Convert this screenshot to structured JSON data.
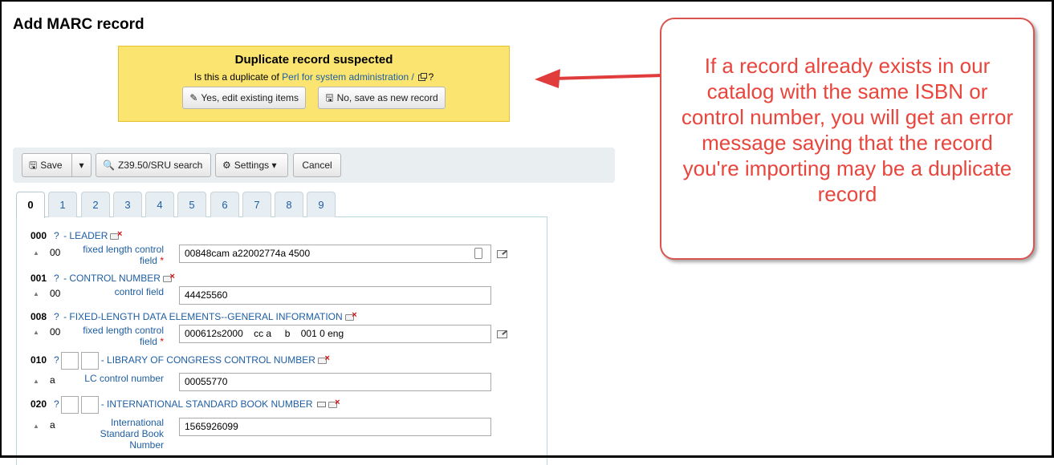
{
  "page": {
    "title": "Add MARC record"
  },
  "duplicate_alert": {
    "title": "Duplicate record suspected",
    "question_prefix": "Is this a duplicate of",
    "record_link": "Perl for system administration /",
    "question_suffix": "?",
    "edit_button": "Yes, edit existing items",
    "new_button": "No, save as new record"
  },
  "callout": {
    "text": "If a record already exists in our catalog with the same ISBN or control number, you will get an error message saying that the record you're importing may be a duplicate record",
    "color": "#e8453c"
  },
  "toolbar": {
    "save": "Save",
    "z3950": "Z39.50/SRU search",
    "settings": "Settings",
    "cancel": "Cancel"
  },
  "tabs": [
    "0",
    "1",
    "2",
    "3",
    "4",
    "5",
    "6",
    "7",
    "8",
    "9"
  ],
  "active_tab": "0",
  "fields": [
    {
      "tag": "000",
      "q": "?",
      "label": "- LEADER",
      "subfield_code": "00",
      "subfield_label": "fixed length control field",
      "required": "*",
      "value": "00848cam a22002774a 4500"
    },
    {
      "tag": "001",
      "q": "?",
      "label": "- CONTROL NUMBER",
      "subfield_code": "00",
      "subfield_label": "control field",
      "value": "44425560"
    },
    {
      "tag": "008",
      "q": "?",
      "label": "- FIXED-LENGTH DATA ELEMENTS--GENERAL INFORMATION",
      "subfield_code": "00",
      "subfield_label": "fixed length control field",
      "required": "*",
      "value": "000612s2000    cc a     b    001 0 eng"
    },
    {
      "tag": "010",
      "q": "?",
      "label": "- LIBRARY OF CONGRESS CONTROL NUMBER",
      "subfield_code": "a",
      "subfield_label": "LC control number",
      "value": "00055770"
    },
    {
      "tag": "020",
      "q": "?",
      "label": "- INTERNATIONAL STANDARD BOOK NUMBER",
      "subfield_code": "a",
      "subfield_label": "International Standard Book Number",
      "value": "1565926099"
    }
  ]
}
